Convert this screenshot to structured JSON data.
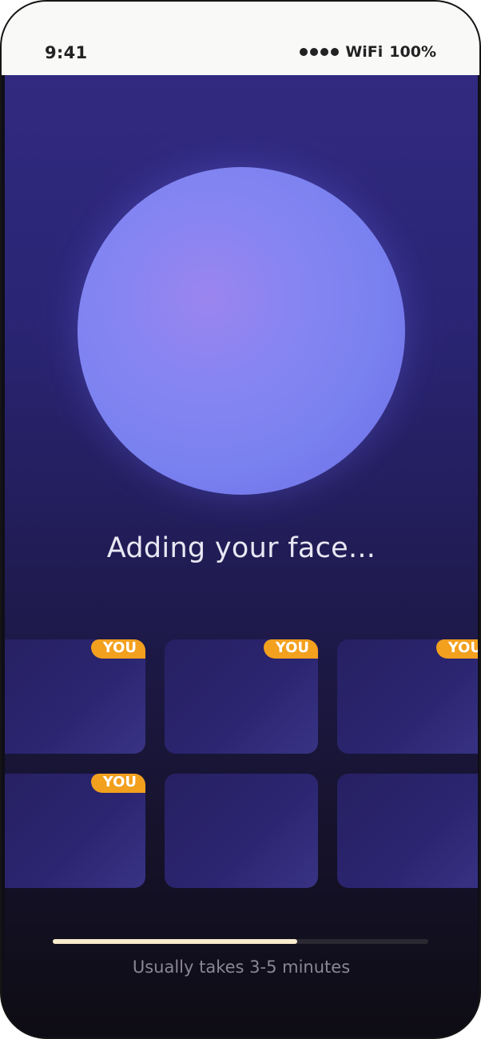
{
  "status_bar": {
    "time": "9:41",
    "network": "WiFi",
    "battery": "100%",
    "signal_bars": 4
  },
  "main": {
    "title": "Adding your face...",
    "grid": [
      {
        "badge": "YOU"
      },
      {
        "badge": "YOU"
      },
      {
        "badge": "YOU"
      },
      {
        "badge": "YOU"
      },
      {
        "badge": ""
      },
      {
        "badge": ""
      }
    ],
    "progress": 0.65,
    "caption": "Usually takes 3-5 minutes"
  },
  "colors": {
    "badge": "#f2a01e",
    "progress_fill": "#f9eccd",
    "orb": "#8785f2"
  }
}
